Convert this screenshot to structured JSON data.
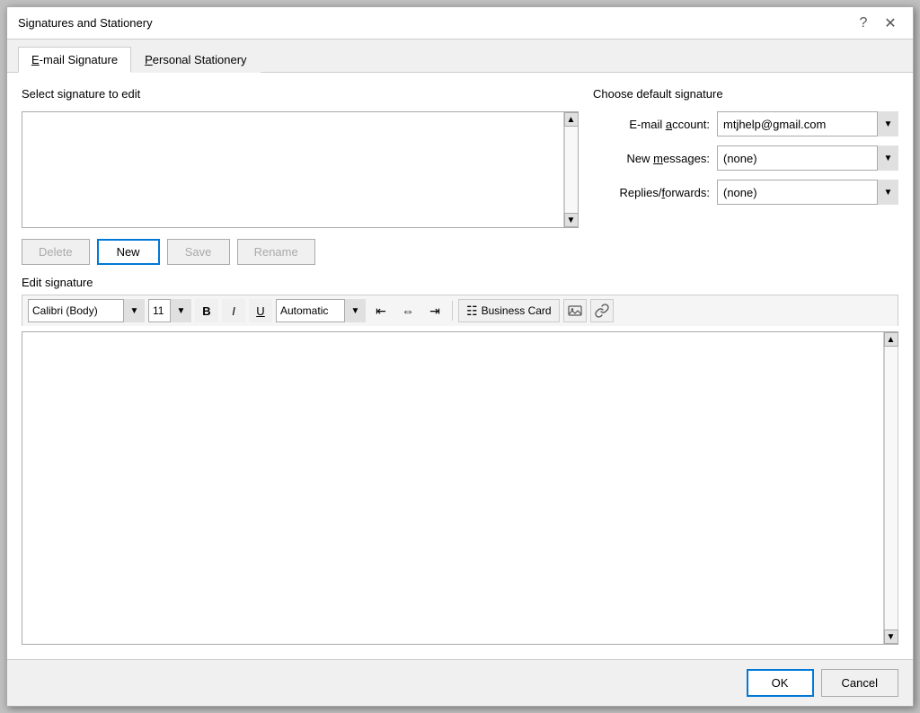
{
  "dialog": {
    "title": "Signatures and Stationery",
    "help_btn": "?",
    "close_btn": "✕"
  },
  "tabs": [
    {
      "id": "email-sig",
      "label_before": "",
      "label": "E-mail Signature",
      "underline": "E",
      "active": true
    },
    {
      "id": "personal-stationery",
      "label_before": "",
      "label": "Personal Stationery",
      "underline": "P",
      "active": false
    }
  ],
  "left_panel": {
    "section_label": "Select signature to edit"
  },
  "buttons": {
    "delete": "Delete",
    "new": "New",
    "save": "Save",
    "rename": "Rename"
  },
  "right_panel": {
    "section_label": "Choose default signature",
    "email_account_label": "E-mail account:",
    "email_account_underline": "a",
    "email_account_value": "mtjhelp@gmail.com",
    "new_messages_label": "New messages:",
    "new_messages_underline": "m",
    "new_messages_value": "(none)",
    "replies_label": "Replies/forwards:",
    "replies_underline": "f",
    "replies_value": "(none)"
  },
  "edit_sig": {
    "label": "Edit signature",
    "font": "Calibri (Body)",
    "size": "11",
    "color": "Automatic",
    "business_card": "Business Card"
  },
  "footer": {
    "ok": "OK",
    "cancel": "Cancel"
  }
}
